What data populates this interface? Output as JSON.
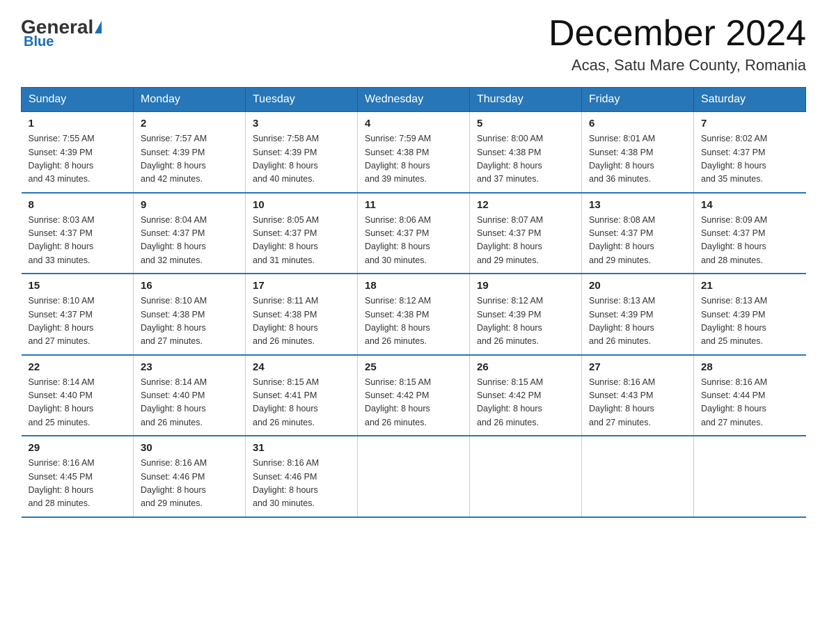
{
  "header": {
    "logo": {
      "general": "General",
      "blue": "Blue",
      "subtitle": "Blue"
    },
    "title": "December 2024",
    "location": "Acas, Satu Mare County, Romania"
  },
  "days_of_week": [
    "Sunday",
    "Monday",
    "Tuesday",
    "Wednesday",
    "Thursday",
    "Friday",
    "Saturday"
  ],
  "weeks": [
    [
      {
        "day": "1",
        "sunrise": "7:55 AM",
        "sunset": "4:39 PM",
        "daylight": "8 hours and 43 minutes."
      },
      {
        "day": "2",
        "sunrise": "7:57 AM",
        "sunset": "4:39 PM",
        "daylight": "8 hours and 42 minutes."
      },
      {
        "day": "3",
        "sunrise": "7:58 AM",
        "sunset": "4:39 PM",
        "daylight": "8 hours and 40 minutes."
      },
      {
        "day": "4",
        "sunrise": "7:59 AM",
        "sunset": "4:38 PM",
        "daylight": "8 hours and 39 minutes."
      },
      {
        "day": "5",
        "sunrise": "8:00 AM",
        "sunset": "4:38 PM",
        "daylight": "8 hours and 37 minutes."
      },
      {
        "day": "6",
        "sunrise": "8:01 AM",
        "sunset": "4:38 PM",
        "daylight": "8 hours and 36 minutes."
      },
      {
        "day": "7",
        "sunrise": "8:02 AM",
        "sunset": "4:37 PM",
        "daylight": "8 hours and 35 minutes."
      }
    ],
    [
      {
        "day": "8",
        "sunrise": "8:03 AM",
        "sunset": "4:37 PM",
        "daylight": "8 hours and 33 minutes."
      },
      {
        "day": "9",
        "sunrise": "8:04 AM",
        "sunset": "4:37 PM",
        "daylight": "8 hours and 32 minutes."
      },
      {
        "day": "10",
        "sunrise": "8:05 AM",
        "sunset": "4:37 PM",
        "daylight": "8 hours and 31 minutes."
      },
      {
        "day": "11",
        "sunrise": "8:06 AM",
        "sunset": "4:37 PM",
        "daylight": "8 hours and 30 minutes."
      },
      {
        "day": "12",
        "sunrise": "8:07 AM",
        "sunset": "4:37 PM",
        "daylight": "8 hours and 29 minutes."
      },
      {
        "day": "13",
        "sunrise": "8:08 AM",
        "sunset": "4:37 PM",
        "daylight": "8 hours and 29 minutes."
      },
      {
        "day": "14",
        "sunrise": "8:09 AM",
        "sunset": "4:37 PM",
        "daylight": "8 hours and 28 minutes."
      }
    ],
    [
      {
        "day": "15",
        "sunrise": "8:10 AM",
        "sunset": "4:37 PM",
        "daylight": "8 hours and 27 minutes."
      },
      {
        "day": "16",
        "sunrise": "8:10 AM",
        "sunset": "4:38 PM",
        "daylight": "8 hours and 27 minutes."
      },
      {
        "day": "17",
        "sunrise": "8:11 AM",
        "sunset": "4:38 PM",
        "daylight": "8 hours and 26 minutes."
      },
      {
        "day": "18",
        "sunrise": "8:12 AM",
        "sunset": "4:38 PM",
        "daylight": "8 hours and 26 minutes."
      },
      {
        "day": "19",
        "sunrise": "8:12 AM",
        "sunset": "4:39 PM",
        "daylight": "8 hours and 26 minutes."
      },
      {
        "day": "20",
        "sunrise": "8:13 AM",
        "sunset": "4:39 PM",
        "daylight": "8 hours and 26 minutes."
      },
      {
        "day": "21",
        "sunrise": "8:13 AM",
        "sunset": "4:39 PM",
        "daylight": "8 hours and 25 minutes."
      }
    ],
    [
      {
        "day": "22",
        "sunrise": "8:14 AM",
        "sunset": "4:40 PM",
        "daylight": "8 hours and 25 minutes."
      },
      {
        "day": "23",
        "sunrise": "8:14 AM",
        "sunset": "4:40 PM",
        "daylight": "8 hours and 26 minutes."
      },
      {
        "day": "24",
        "sunrise": "8:15 AM",
        "sunset": "4:41 PM",
        "daylight": "8 hours and 26 minutes."
      },
      {
        "day": "25",
        "sunrise": "8:15 AM",
        "sunset": "4:42 PM",
        "daylight": "8 hours and 26 minutes."
      },
      {
        "day": "26",
        "sunrise": "8:15 AM",
        "sunset": "4:42 PM",
        "daylight": "8 hours and 26 minutes."
      },
      {
        "day": "27",
        "sunrise": "8:16 AM",
        "sunset": "4:43 PM",
        "daylight": "8 hours and 27 minutes."
      },
      {
        "day": "28",
        "sunrise": "8:16 AM",
        "sunset": "4:44 PM",
        "daylight": "8 hours and 27 minutes."
      }
    ],
    [
      {
        "day": "29",
        "sunrise": "8:16 AM",
        "sunset": "4:45 PM",
        "daylight": "8 hours and 28 minutes."
      },
      {
        "day": "30",
        "sunrise": "8:16 AM",
        "sunset": "4:46 PM",
        "daylight": "8 hours and 29 minutes."
      },
      {
        "day": "31",
        "sunrise": "8:16 AM",
        "sunset": "4:46 PM",
        "daylight": "8 hours and 30 minutes."
      },
      null,
      null,
      null,
      null
    ]
  ]
}
